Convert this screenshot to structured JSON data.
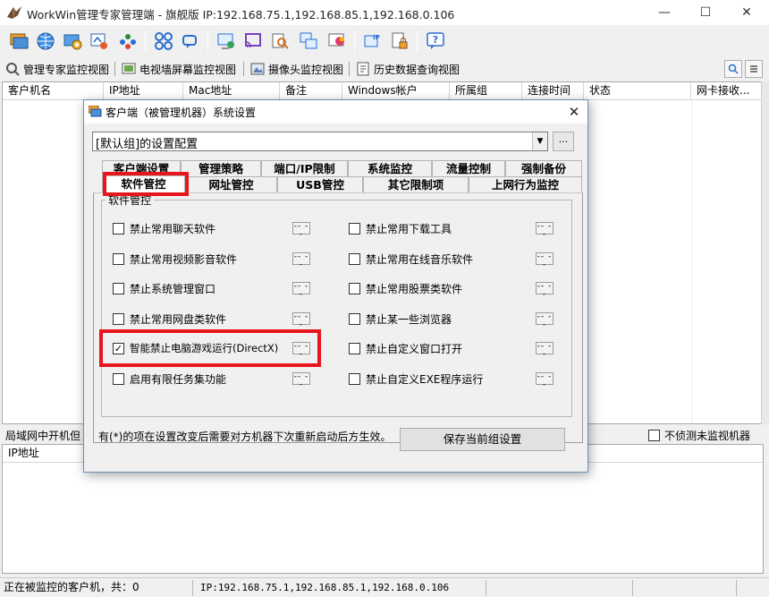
{
  "window": {
    "title": "WorkWin管理专家管理端 - 旗舰版 IP:192.168.75.1,192.168.85.1,192.168.0.106",
    "controls": {
      "minimize": "—",
      "maximize": "☐",
      "close": "✕"
    }
  },
  "toolbar": {
    "icons": [
      "clients-icon",
      "globe-icon",
      "settings-icon",
      "monitor-refresh-icon",
      "users-icon",
      "grid-icon",
      "search-doc-icon",
      "screen-icon",
      "cast-icon",
      "magnify-doc-icon",
      "windows-icon",
      "chart-icon",
      "ip-icon",
      "lock-doc-icon",
      "help-icon"
    ]
  },
  "view_tabs": [
    {
      "label": "管理专家监控视图"
    },
    {
      "label": "电视墙屏幕监控视图"
    },
    {
      "label": "摄像头监控视图"
    },
    {
      "label": "历史数据查询视图"
    }
  ],
  "client_table": {
    "columns": [
      "客户机名",
      "IP地址",
      "Mac地址",
      "备注",
      "Windows帐户",
      "所属组",
      "连接时间",
      "状态",
      "网卡接收..."
    ]
  },
  "lower_panel": {
    "label_partial": "局域网中开机但",
    "checkbox_label": "不侦测未监视机器",
    "column": "IP地址"
  },
  "status_bar": {
    "left": "正在被监控的客户机，共：0",
    "ip": "IP:192.168.75.1,192.168.85.1,192.168.0.106"
  },
  "dialog": {
    "title": "客户端（被管理机器）系统设置",
    "close": "✕",
    "config_value": "[默认组]的设置配置",
    "config_more": "...",
    "tabs_row1": [
      "客户端设置",
      "管理策略",
      "端口/IP限制",
      "系统监控",
      "流量控制",
      "强制备份"
    ],
    "tabs_row2": [
      "软件管控",
      "网址管控",
      "USB管控",
      "其它限制项",
      "上网行为监控"
    ],
    "group_title": "软件管控",
    "options_left": [
      {
        "label": "禁止常用聊天软件",
        "checked": false
      },
      {
        "label": "禁止常用视频影音软件",
        "checked": false
      },
      {
        "label": "禁止系统管理窗口",
        "checked": false
      },
      {
        "label": "禁止常用网盘类软件",
        "checked": false
      },
      {
        "label": "智能禁止电脑游戏运行(DirectX)",
        "checked": true
      },
      {
        "label": "启用有限任务集功能",
        "checked": false
      }
    ],
    "options_right": [
      {
        "label": "禁止常用下载工具",
        "checked": false
      },
      {
        "label": "禁止常用在线音乐软件",
        "checked": false
      },
      {
        "label": "禁止常用股票类软件",
        "checked": false
      },
      {
        "label": "禁止某一些浏览器",
        "checked": false
      },
      {
        "label": "禁止自定义窗口打开",
        "checked": false
      },
      {
        "label": "禁止自定义EXE程序运行",
        "checked": false
      }
    ],
    "dots_label": "-- --",
    "note": "有(*)的项在设置改变后需要对方机器下次重新启动后方生效。",
    "save_button": "保存当前组设置"
  },
  "colors": {
    "highlight": "#e8151d",
    "dialog_border": "#6c8fb6"
  }
}
